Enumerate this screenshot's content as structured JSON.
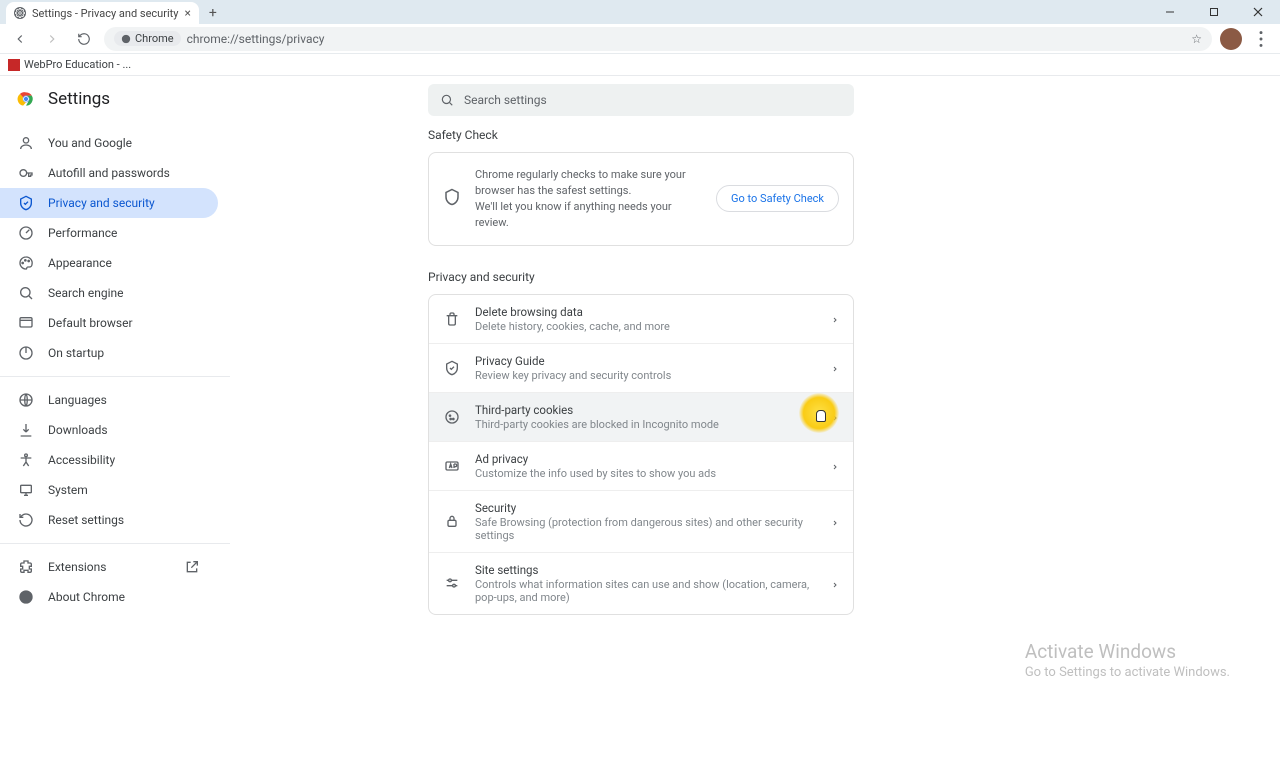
{
  "window": {
    "tab_title": "Settings - Privacy and security",
    "omnibox_chip": "Chrome",
    "omnibox_url": "chrome://settings/privacy"
  },
  "bookmarks": {
    "item1": "WebPro Education - ..."
  },
  "header": {
    "title": "Settings"
  },
  "search": {
    "placeholder": "Search settings"
  },
  "sidebar": {
    "you_google": "You and Google",
    "autofill": "Autofill and passwords",
    "privacy": "Privacy and security",
    "performance": "Performance",
    "appearance": "Appearance",
    "search_engine": "Search engine",
    "default_browser": "Default browser",
    "on_startup": "On startup",
    "languages": "Languages",
    "downloads": "Downloads",
    "accessibility": "Accessibility",
    "system": "System",
    "reset": "Reset settings",
    "extensions": "Extensions",
    "about": "About Chrome"
  },
  "main": {
    "safety_check_heading": "Safety Check",
    "safety_text_l1": "Chrome regularly checks to make sure your browser has the safest settings.",
    "safety_text_l2": "We'll let you know if anything needs your review.",
    "safety_button": "Go to Safety Check",
    "privacy_heading": "Privacy and security",
    "rows": {
      "delete_title": "Delete browsing data",
      "delete_sub": "Delete history, cookies, cache, and more",
      "guide_title": "Privacy Guide",
      "guide_sub": "Review key privacy and security controls",
      "cookies_title": "Third-party cookies",
      "cookies_sub": "Third-party cookies are blocked in Incognito mode",
      "ad_title": "Ad privacy",
      "ad_sub": "Customize the info used by sites to show you ads",
      "security_title": "Security",
      "security_sub": "Safe Browsing (protection from dangerous sites) and other security settings",
      "site_title": "Site settings",
      "site_sub": "Controls what information sites can use and show (location, camera, pop-ups, and more)"
    }
  },
  "watermark": {
    "l1": "Activate Windows",
    "l2": "Go to Settings to activate Windows."
  }
}
